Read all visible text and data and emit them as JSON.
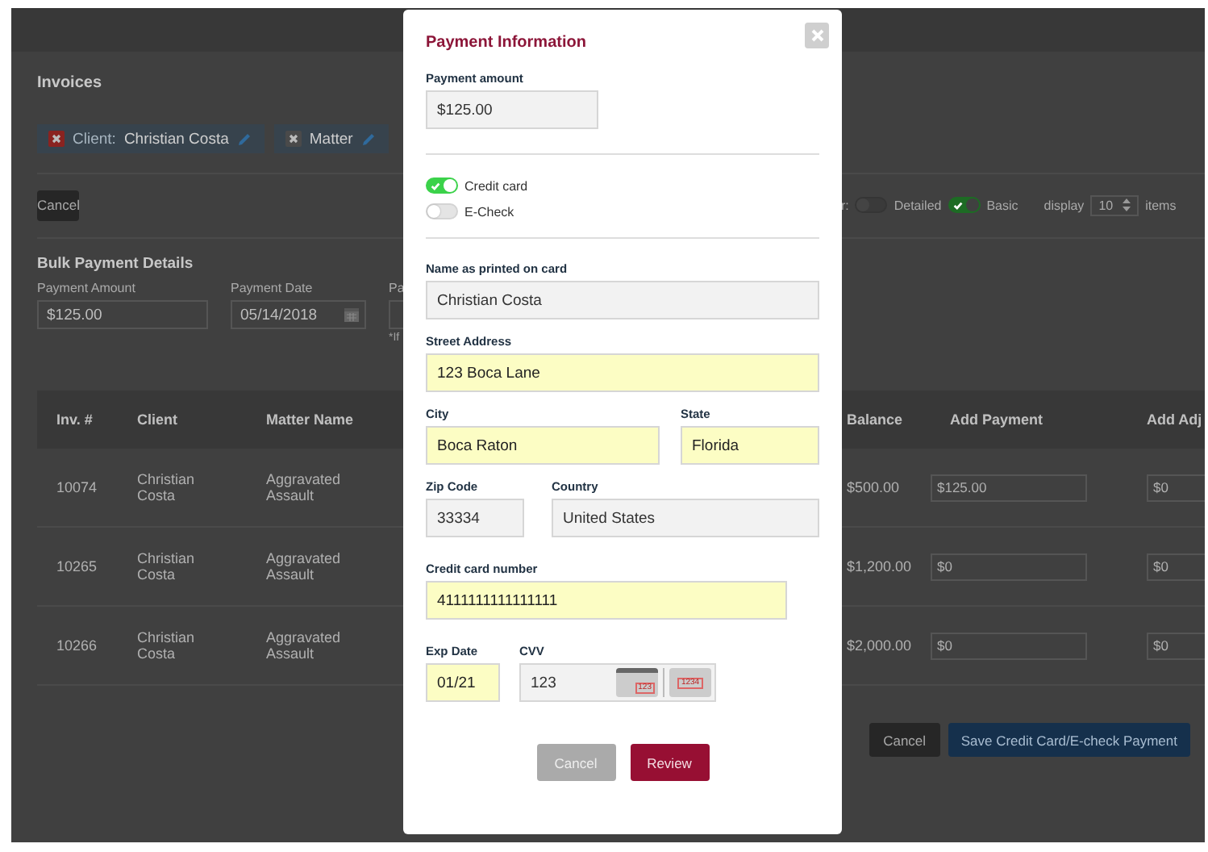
{
  "page": {
    "title": "Invoices",
    "filters": [
      {
        "label": "Client:",
        "value": "Christian Costa",
        "active": true
      },
      {
        "value": "Matter",
        "active": false
      }
    ],
    "cancel_button": "Cancel",
    "view": {
      "prefix": "r:",
      "options": [
        {
          "label": "Detailed",
          "on": false
        },
        {
          "label": "Basic",
          "on": true
        }
      ],
      "display_label": "display",
      "display_value": "10",
      "display_suffix": "items"
    },
    "bulk": {
      "title": "Bulk Payment Details",
      "fields": [
        {
          "kind": "text",
          "label": "Payment Amount",
          "value": "$125.00"
        },
        {
          "kind": "date",
          "label": "Payment Date",
          "value": "05/14/2018"
        },
        {
          "kind": "text",
          "label": "Pa",
          "note": "*If"
        }
      ]
    },
    "table": {
      "columns": [
        "Inv. #",
        "Client",
        "Matter Name",
        "Balance",
        "Add Payment",
        "Add Adj"
      ],
      "rows": [
        {
          "cells": [
            "10074",
            "Christian Costa",
            "Aggravated Assault",
            "$500.00",
            "$125.00",
            "$0"
          ]
        },
        {
          "cells": [
            "10265",
            "Christian Costa",
            "Aggravated Assault",
            "$1,200.00",
            "$0",
            "$0"
          ]
        },
        {
          "cells": [
            "10266",
            "Christian Costa",
            "Aggravated Assault",
            "$2,000.00",
            "$0",
            "$0"
          ]
        }
      ]
    },
    "footer_buttons": [
      {
        "label": "Cancel",
        "kind": "secondary"
      },
      {
        "label": "Save Credit Card/E-check Payment",
        "kind": "primary"
      }
    ]
  },
  "modal": {
    "title": "Payment Information",
    "amount": {
      "label": "Payment amount",
      "value": "$125.00"
    },
    "methods": [
      {
        "label": "Credit card",
        "selected": true
      },
      {
        "label": "E-Check",
        "selected": false
      }
    ],
    "fields": [
      {
        "kind": "text",
        "label": "Name as printed on card",
        "value": "Christian Costa",
        "autofilled": false
      },
      {
        "kind": "text",
        "label": "Street Address",
        "value": "123 Boca Lane",
        "autofilled": true
      },
      {
        "kind": "text",
        "label": "City",
        "value": "Boca Raton",
        "autofilled": true
      },
      {
        "kind": "text",
        "label": "State",
        "value": "Florida",
        "autofilled": true
      },
      {
        "kind": "text",
        "label": "Zip Code",
        "value": "33334",
        "autofilled": false
      },
      {
        "kind": "text",
        "label": "Country",
        "value": "United States",
        "autofilled": false
      },
      {
        "kind": "text",
        "label": "Credit card number",
        "value": "4111111111111111",
        "autofilled": true
      },
      {
        "kind": "text",
        "label": "Exp Date",
        "value": "01/21",
        "autofilled": true
      },
      {
        "kind": "cvv",
        "label": "CVV",
        "value": "123",
        "autofilled": false
      }
    ],
    "cvv_hints": [
      "123",
      "1234"
    ],
    "buttons": [
      {
        "label": "Cancel",
        "kind": "secondary"
      },
      {
        "label": "Review",
        "kind": "primary"
      }
    ]
  }
}
